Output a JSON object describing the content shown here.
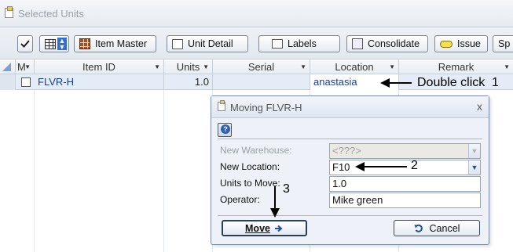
{
  "window": {
    "title": "Selected Units"
  },
  "toolbar": {
    "item_master_label": "Item Master",
    "unit_detail_label": "Unit Detail",
    "labels_label": "Labels",
    "consolidate_label": "Consolidate",
    "issue_label": "Issue",
    "split_label": "Sp"
  },
  "grid": {
    "columns": [
      "M",
      "Item ID",
      "Units",
      "Serial",
      "Location",
      "Remark"
    ],
    "rows": [
      {
        "item_id": "FLVR-H",
        "units": "1.0",
        "serial": "",
        "location": "anastasia",
        "remark": ""
      }
    ]
  },
  "annotations": {
    "a1_text": "Double click",
    "a1_num": "1",
    "a2_num": "2",
    "a3_num": "3"
  },
  "dialog": {
    "title": "Moving FLVR-H",
    "close_glyph": "x",
    "new_warehouse_label": "New Warehouse:",
    "new_warehouse_value": "<???>",
    "new_location_label": "New Location:",
    "new_location_value": "F10",
    "units_to_move_label": "Units to Move:",
    "units_to_move_value": "1.0",
    "operator_label": "Operator:",
    "operator_value": "Mike green",
    "move_label": "Move",
    "cancel_label": "Cancel"
  }
}
